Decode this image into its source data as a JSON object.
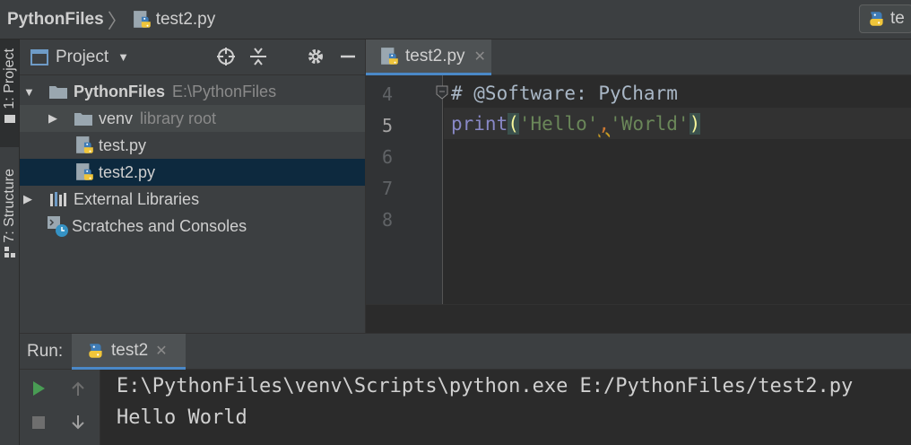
{
  "breadcrumb": {
    "project": "PythonFiles",
    "file": "test2.py"
  },
  "run_config": {
    "label": "te"
  },
  "tool_strip": {
    "project_tab": "1: Project",
    "structure_tab": "7: Structure"
  },
  "project_panel": {
    "title": "Project",
    "tree": [
      {
        "label": "PythonFiles",
        "hint": "E:\\PythonFiles"
      },
      {
        "label": "venv",
        "hint": "library root"
      },
      {
        "label": "test.py"
      },
      {
        "label": "test2.py"
      },
      {
        "label": "External Libraries"
      },
      {
        "label": "Scratches and Consoles"
      }
    ]
  },
  "editor": {
    "tab_label": "test2.py",
    "line_numbers": [
      "4",
      "5",
      "6",
      "7",
      "8"
    ],
    "comment_line": "# @Software: PyCharm",
    "code": {
      "func": "print",
      "open_paren": "(",
      "str1": "'Hello'",
      "comma": ",",
      "str2": "'World'",
      "close_paren": ")"
    }
  },
  "run_panel": {
    "label": "Run:",
    "tab_label": "test2",
    "output": [
      "E:\\PythonFiles\\venv\\Scripts\\python.exe E:/PythonFiles/test2.py",
      "Hello World"
    ]
  },
  "colors": {
    "selection": "#0d293e",
    "accent": "#4a88c7",
    "play": "#499c54"
  }
}
